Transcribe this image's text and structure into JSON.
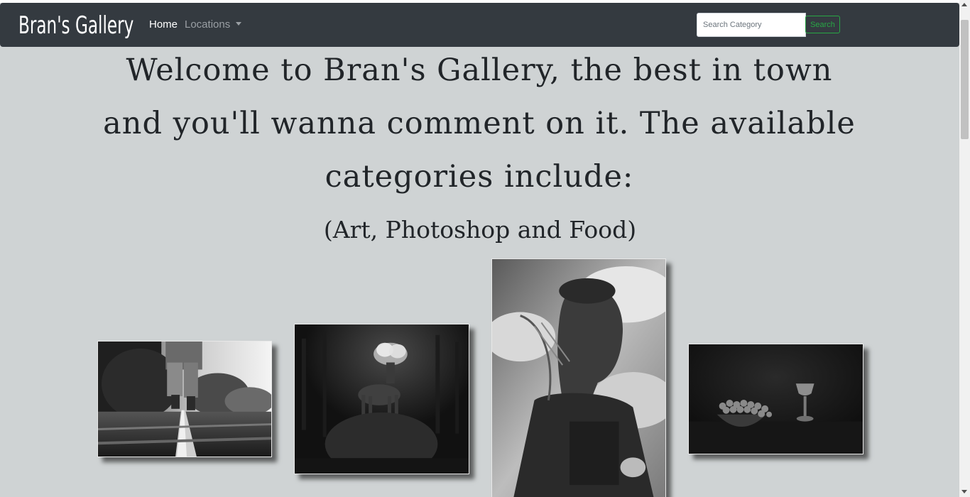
{
  "navbar": {
    "brand": "Bran's Gallery",
    "home_label": "Home",
    "locations_label": "Locations"
  },
  "search": {
    "placeholder": "Search Category",
    "button_label": "Search"
  },
  "main": {
    "welcome": "Welcome to Bran's Gallery, the best in town and you'll wanna comment on it. The available categories include:",
    "categories": "(Art, Photoshop and Food)"
  },
  "gallery": {
    "images": [
      {
        "name": "railway-walker-photo"
      },
      {
        "name": "stag-with-smoke-antlers-photo"
      },
      {
        "name": "double-exposure-man-photo"
      },
      {
        "name": "grapes-still-life-photo"
      }
    ]
  },
  "colors": {
    "navbar_bg": "#343a40",
    "page_bg": "#cfd3d4",
    "search_accent": "#28a745"
  }
}
